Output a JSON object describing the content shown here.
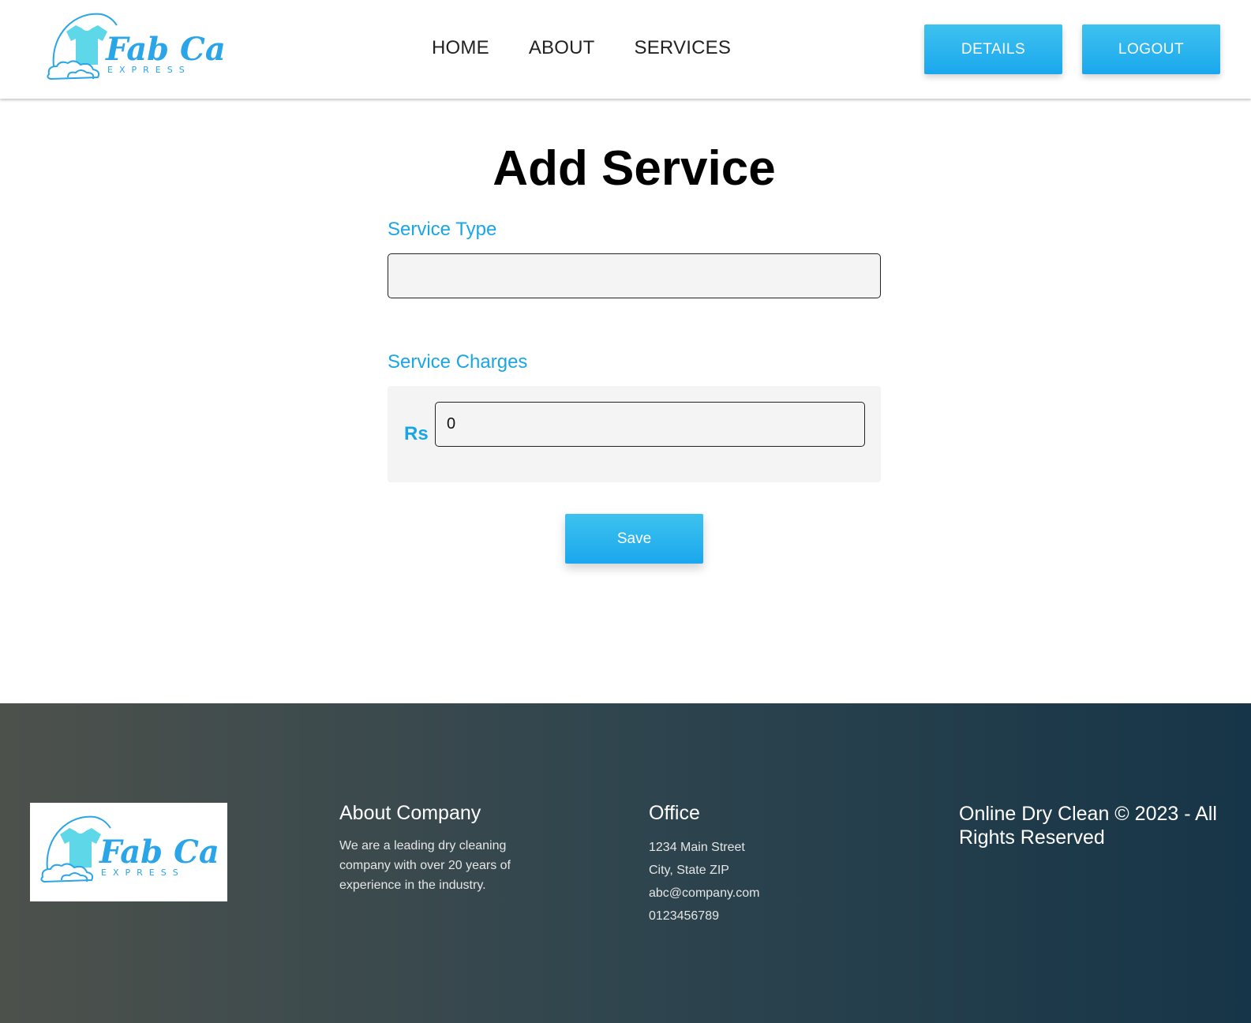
{
  "brand": {
    "name": "Fab Care",
    "tagline": "EXPRESS"
  },
  "nav": {
    "items": [
      "HOME",
      "ABOUT",
      "SERVICES"
    ]
  },
  "header": {
    "details_label": "DETAILS",
    "logout_label": "LOGOUT"
  },
  "form": {
    "title": "Add Service",
    "service_type_label": "Service Type",
    "service_type_value": "",
    "service_charges_label": "Service Charges",
    "currency": "Rs",
    "charge_value": "0",
    "save_label": "Save"
  },
  "footer": {
    "about_title": "About Company",
    "about_text": "We are a leading dry cleaning company with over 20 years of experience in the industry.",
    "office_title": "Office",
    "office_lines": [
      "1234 Main Street",
      "City, State ZIP",
      "abc@company.com",
      "0123456789"
    ],
    "copyright": "Online Dry Clean © 2023 - All Rights Reserved"
  },
  "colors": {
    "accent": "#1aa6e6",
    "button": "#24b2ee",
    "footer_start": "#4d514c",
    "footer_end": "#163548"
  }
}
